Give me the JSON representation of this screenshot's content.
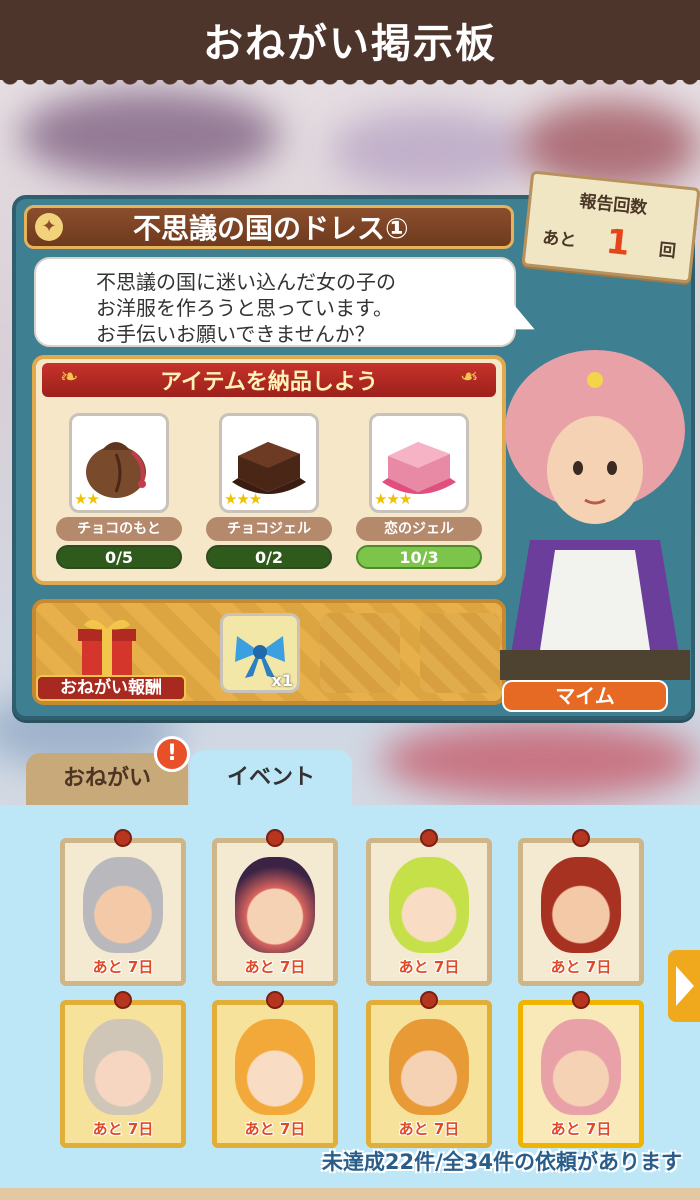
{
  "header": {
    "title": "おねがい掲示板"
  },
  "quest": {
    "title": "不思議の国のドレス①",
    "message_lines": [
      "不思議の国に迷い込んだ女の子の",
      "お洋服を作ろうと思っています。",
      "お手伝いお願いできませんか？"
    ],
    "report": {
      "label": "報告回数",
      "prefix": "あと",
      "count": "1",
      "unit": "回"
    },
    "delivery": {
      "header": "アイテムを納品しよう",
      "items": [
        {
          "name": "チョコのもと",
          "stars": "★★",
          "progress": "0/5",
          "complete": false,
          "icon": "cocoa-sack-icon"
        },
        {
          "name": "チョコジェル",
          "stars": "★★★",
          "progress": "0/2",
          "complete": false,
          "icon": "chocolate-gel-icon"
        },
        {
          "name": "恋のジェル",
          "stars": "★★★",
          "progress": "10/3",
          "complete": true,
          "icon": "love-gel-icon"
        }
      ]
    },
    "reward": {
      "label": "おねがい報酬",
      "item_icon": "blue-ribbon-icon",
      "qty": "x1"
    },
    "character_name": "マイム"
  },
  "tabs": [
    {
      "label": "おねがい",
      "active": false,
      "alert": "!"
    },
    {
      "label": "イベント",
      "active": true
    }
  ],
  "event_board": {
    "portraits": [
      {
        "character": "armored-knight",
        "timer": "あと 7日",
        "frame": "plain"
      },
      {
        "character": "red-haired-witch",
        "timer": "あと 7日",
        "frame": "plain"
      },
      {
        "character": "green-haired-girl",
        "timer": "あと 7日",
        "frame": "plain"
      },
      {
        "character": "mustached-man",
        "timer": "あと 7日",
        "frame": "plain"
      },
      {
        "character": "grey-haired-girl",
        "timer": "あと 7日",
        "frame": "gold"
      },
      {
        "character": "sheep-horn-girl",
        "timer": "あと 7日",
        "frame": "gold"
      },
      {
        "character": "bandana-boy",
        "timer": "あと 7日",
        "frame": "gold"
      },
      {
        "character": "pink-haired-grandma",
        "timer": "あと 7日",
        "frame": "highlight"
      }
    ],
    "summary": "未達成22件/全34件の依頼があります"
  },
  "colors": {
    "header_bg": "#4e352b",
    "panel_bg": "#3f7f92",
    "delivery_header": "#c6332c",
    "progress_incomplete": "#2e5a1c",
    "progress_complete": "#7cc44a",
    "timer_text": "#e04a24",
    "board_bg": "#bde6f7"
  }
}
